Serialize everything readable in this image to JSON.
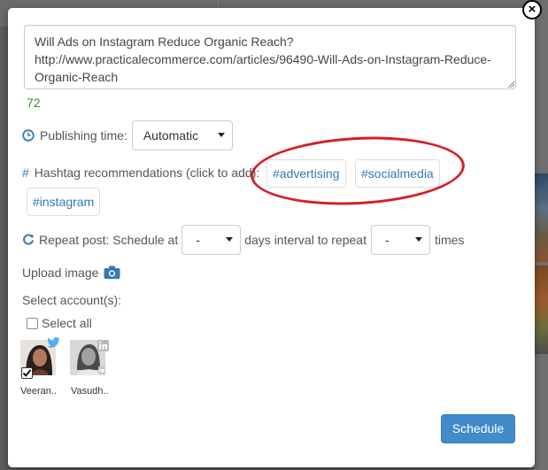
{
  "post": {
    "text": "Will Ads on Instagram Reduce Organic Reach?\nhttp://www.practicalecommerce.com/articles/96490-Will-Ads-on-Instagram-Reduce-Organic-Reach",
    "char_count": "72"
  },
  "publishing": {
    "label": "Publishing time:",
    "selected": "Automatic"
  },
  "hashtags": {
    "label": "Hashtag recommendations (click to add):",
    "items": [
      "#advertising",
      "#socialmedia",
      "#instagram"
    ]
  },
  "repeat": {
    "label_prefix": "Repeat post: Schedule at",
    "days_selected": "-",
    "label_middle": "days interval to repeat",
    "times_selected": "-",
    "label_suffix": "times"
  },
  "upload": {
    "label": "Upload image"
  },
  "accounts": {
    "label": "Select account(s):",
    "select_all_label": "Select all",
    "items": [
      {
        "name": "Veeran..",
        "network": "twitter",
        "checked": true
      },
      {
        "name": "Vasudh..",
        "network": "linkedin",
        "checked": false
      }
    ]
  },
  "actions": {
    "schedule_label": "Schedule",
    "close_symbol": "×"
  },
  "colors": {
    "accent": "#337ab7",
    "primary_button": "#428bca",
    "count_green": "#3c8a2e",
    "annotation_red": "#d41f2b"
  }
}
